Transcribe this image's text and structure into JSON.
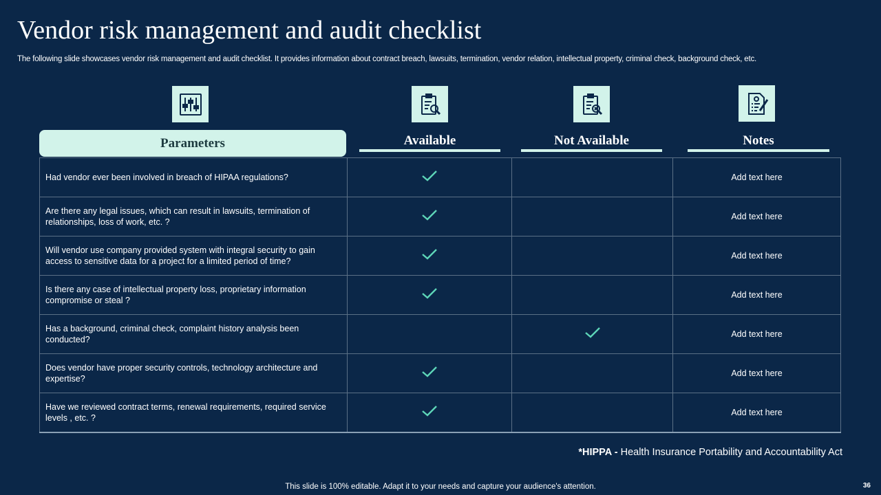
{
  "slide": {
    "title": "Vendor risk management and audit checklist",
    "subtitle": "The following slide showcases vendor risk management and audit checklist. It provides information about contract breach, lawsuits, termination, vendor relation, intellectual property, criminal check, background check, etc.",
    "page_number": "36",
    "footer": "This slide is 100% editable. Adapt it to your needs and capture your audience's attention."
  },
  "icons": {
    "parameters": "sliders-icon",
    "available": "clipboard-search-icon",
    "not_available": "clipboard-reject-icon",
    "notes": "document-edit-icon"
  },
  "table": {
    "headers": {
      "parameters": "Parameters",
      "available": "Available",
      "not_available": "Not Available",
      "notes": "Notes"
    },
    "rows": [
      {
        "question": "Had vendor ever been involved in breach of HIPAA regulations?",
        "available": true,
        "not_available": false,
        "note": "Add text here"
      },
      {
        "question": "Are there any legal issues, which can result in lawsuits, termination of relationships, loss of work, etc. ?",
        "available": true,
        "not_available": false,
        "note": "Add text here"
      },
      {
        "question": "Will vendor use company provided system with integral security to gain access to sensitive data for a project for a limited period of time?",
        "available": true,
        "not_available": false,
        "note": "Add text here"
      },
      {
        "question": "Is there any case of intellectual property loss, proprietary information compromise or steal ?",
        "available": true,
        "not_available": false,
        "note": "Add text here"
      },
      {
        "question": "Has a background, criminal check, complaint history analysis been conducted?",
        "available": false,
        "not_available": true,
        "note": "Add text here"
      },
      {
        "question": "Does vendor have proper security controls, technology architecture and expertise?",
        "available": true,
        "not_available": false,
        "note": "Add text here"
      },
      {
        "question": "Have we reviewed contract terms, renewal requirements, required service levels , etc. ?",
        "available": true,
        "not_available": false,
        "note": "Add text here"
      }
    ]
  },
  "footnote": {
    "term": "*HIPPA -",
    "definition": "Health Insurance Portability and Accountability Act"
  },
  "colors": {
    "background": "#0b2748",
    "accent": "#d2f3ea",
    "check": "#5ed6b8"
  }
}
